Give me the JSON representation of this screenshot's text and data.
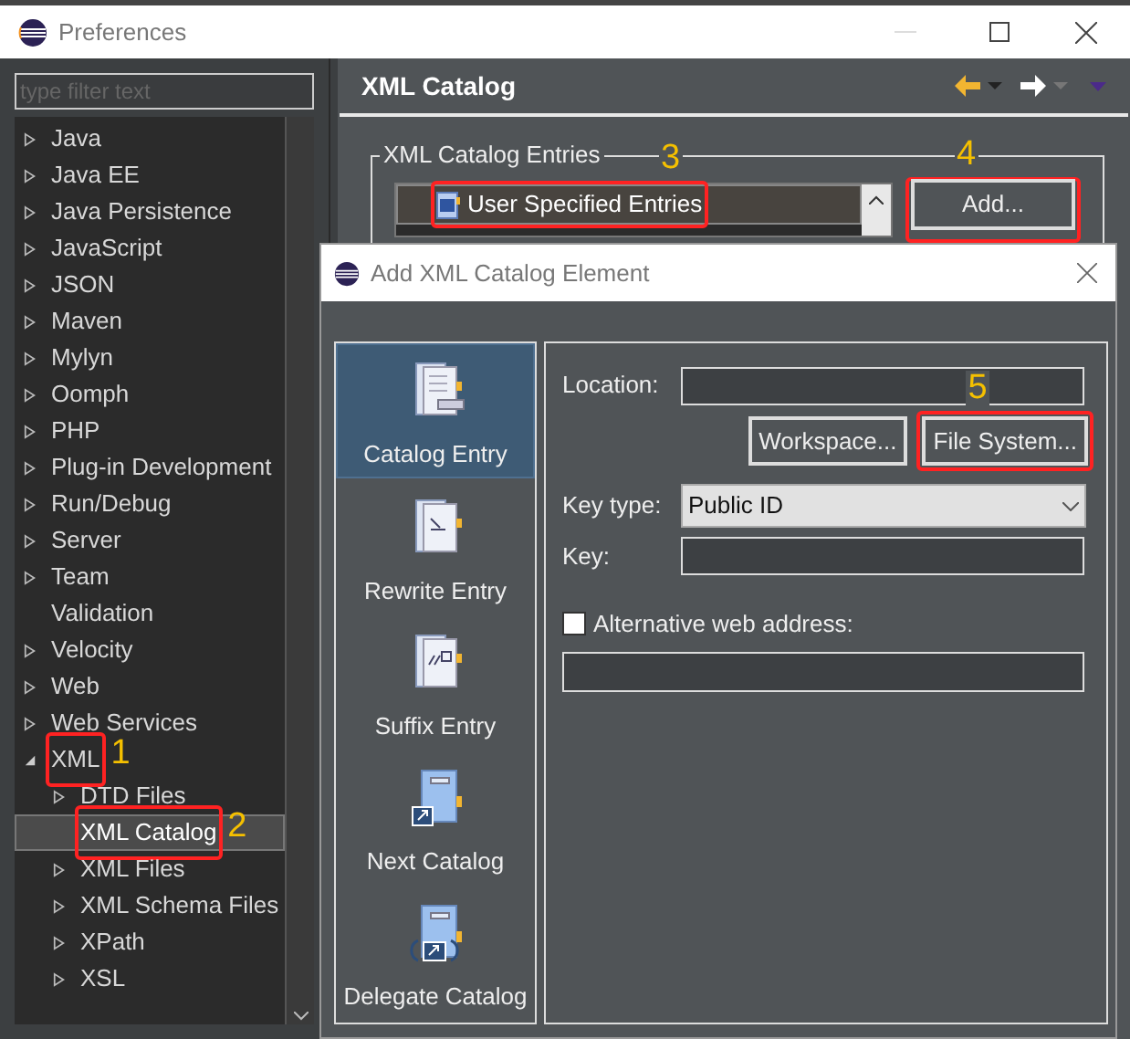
{
  "window": {
    "title": "Preferences"
  },
  "filter": {
    "placeholder": "type filter text"
  },
  "tree": [
    {
      "label": "Java",
      "kind": "folder",
      "expanded": false,
      "selected": false
    },
    {
      "label": "Java EE",
      "kind": "folder",
      "expanded": false,
      "selected": false
    },
    {
      "label": "Java Persistence",
      "kind": "folder",
      "expanded": false,
      "selected": false
    },
    {
      "label": "JavaScript",
      "kind": "folder",
      "expanded": false,
      "selected": false
    },
    {
      "label": "JSON",
      "kind": "folder",
      "expanded": false,
      "selected": false
    },
    {
      "label": "Maven",
      "kind": "folder",
      "expanded": false,
      "selected": false
    },
    {
      "label": "Mylyn",
      "kind": "folder",
      "expanded": false,
      "selected": false
    },
    {
      "label": "Oomph",
      "kind": "folder",
      "expanded": false,
      "selected": false
    },
    {
      "label": "PHP",
      "kind": "folder",
      "expanded": false,
      "selected": false
    },
    {
      "label": "Plug-in Development",
      "kind": "folder",
      "expanded": false,
      "selected": false
    },
    {
      "label": "Run/Debug",
      "kind": "folder",
      "expanded": false,
      "selected": false
    },
    {
      "label": "Server",
      "kind": "folder",
      "expanded": false,
      "selected": false
    },
    {
      "label": "Team",
      "kind": "folder",
      "expanded": false,
      "selected": false
    },
    {
      "label": "Validation",
      "kind": "leaf",
      "selected": false
    },
    {
      "label": "Velocity",
      "kind": "folder",
      "expanded": false,
      "selected": false
    },
    {
      "label": "Web",
      "kind": "folder",
      "expanded": false,
      "selected": false
    },
    {
      "label": "Web Services",
      "kind": "folder",
      "expanded": false,
      "selected": false
    },
    {
      "label": "XML",
      "kind": "folder",
      "expanded": true,
      "selected": false,
      "annotation": "1",
      "children": [
        {
          "label": "DTD Files",
          "kind": "folder",
          "expanded": false,
          "selected": false
        },
        {
          "label": "XML Catalog",
          "kind": "leaf",
          "selected": true,
          "annotation": "2"
        },
        {
          "label": "XML Files",
          "kind": "folder",
          "expanded": false,
          "selected": false
        },
        {
          "label": "XML Schema Files",
          "kind": "folder",
          "expanded": false,
          "selected": false
        },
        {
          "label": "XPath",
          "kind": "folder",
          "expanded": false,
          "selected": false
        },
        {
          "label": "XSL",
          "kind": "folder",
          "expanded": false,
          "selected": false
        }
      ]
    }
  ],
  "page": {
    "title": "XML Catalog",
    "group_title": "XML Catalog Entries",
    "entries": [
      {
        "label": "User Specified Entries",
        "selected": true,
        "annotation": "3"
      }
    ],
    "add_button": {
      "label": "Add...",
      "annotation": "4"
    }
  },
  "dialog": {
    "title": "Add XML Catalog Element",
    "types": [
      {
        "label": "Catalog Entry",
        "kind": "catalog",
        "selected": true
      },
      {
        "label": "Rewrite Entry",
        "kind": "rewrite",
        "selected": false
      },
      {
        "label": "Suffix Entry",
        "kind": "suffix",
        "selected": false
      },
      {
        "label": "Next Catalog",
        "kind": "next",
        "selected": false
      },
      {
        "label": "Delegate Catalog",
        "kind": "delegate",
        "selected": false
      }
    ],
    "location_label": "Location:",
    "workspace_button": "Workspace...",
    "file_system_button": {
      "label": "File System...",
      "annotation": "5"
    },
    "key_type_label": "Key type:",
    "key_type_value": "Public ID",
    "key_label": "Key:",
    "alternative": {
      "label": "Alternative web address:",
      "checked": false
    }
  }
}
